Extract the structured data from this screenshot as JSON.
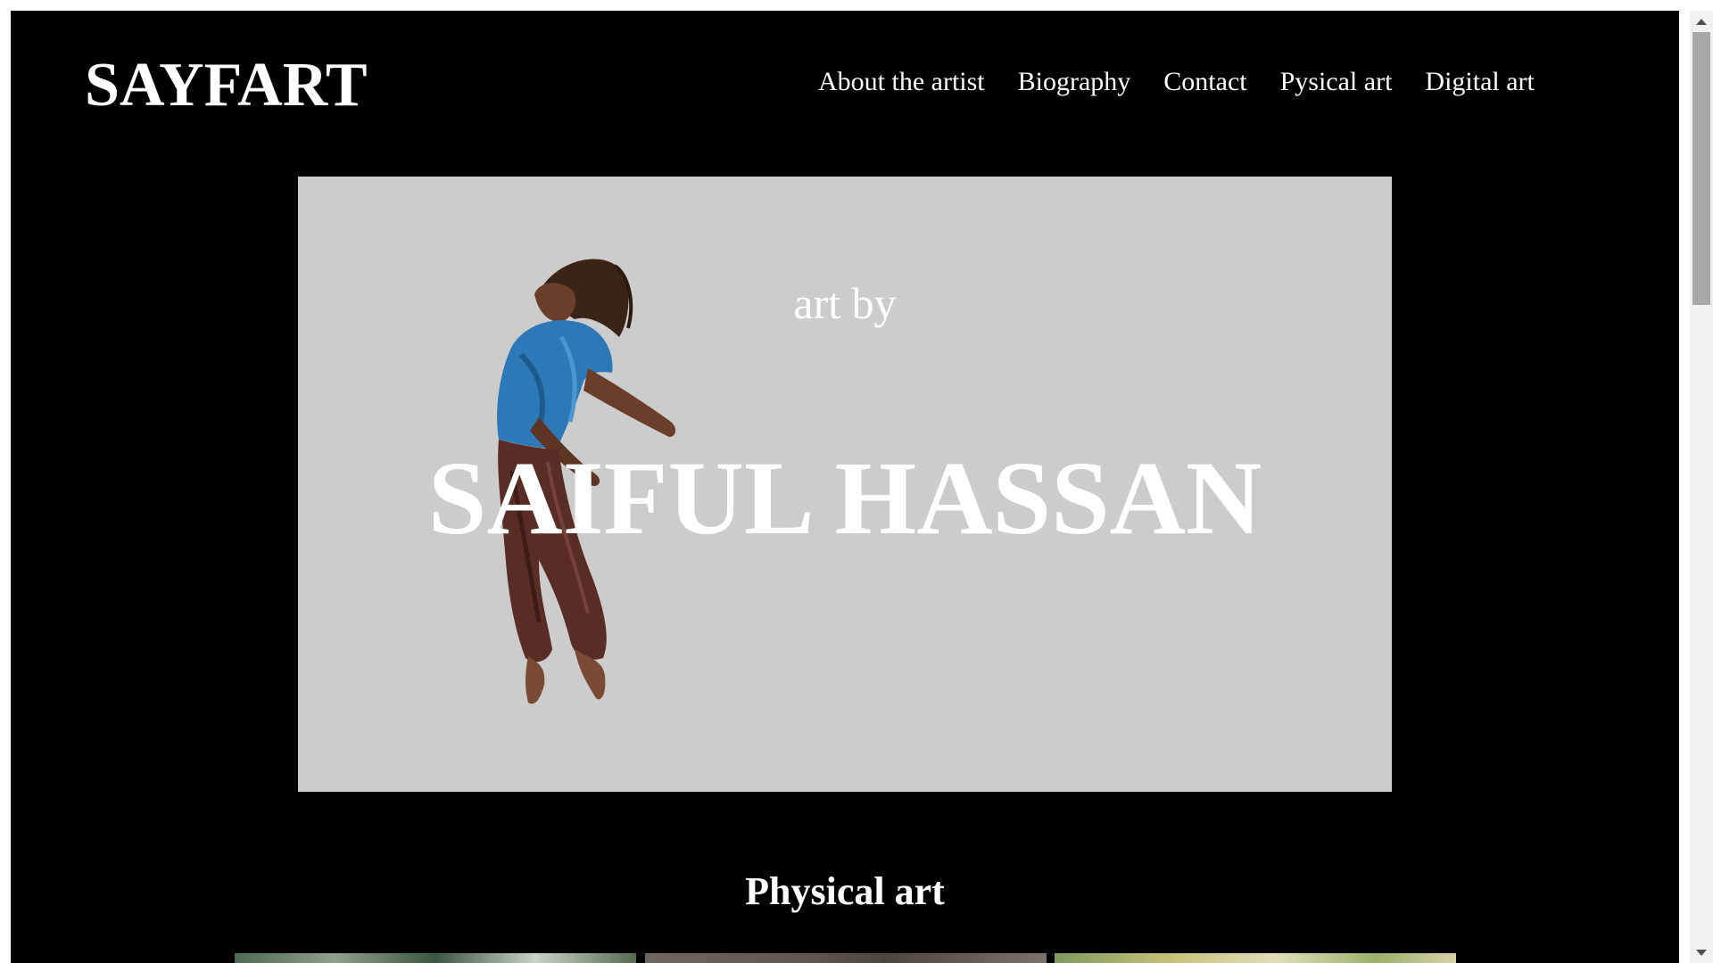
{
  "site": {
    "logo": "SAYFART"
  },
  "nav": {
    "items": [
      {
        "label": "About the artist"
      },
      {
        "label": "Biography"
      },
      {
        "label": "Contact"
      },
      {
        "label": "Pysical art"
      },
      {
        "label": "Digital art"
      }
    ]
  },
  "hero": {
    "subtitle": "art by",
    "title": "SAIFUL HASSAN",
    "background_color": "#cccccc",
    "image": "painting of a person leaping backwards wearing a blue t-shirt"
  },
  "physical_art": {
    "heading": "Physical art",
    "thumbnails": [
      {
        "icon": "artwork-thumbnail"
      },
      {
        "icon": "artwork-thumbnail"
      },
      {
        "icon": "artwork-thumbnail"
      }
    ]
  },
  "colors": {
    "page_background": "#000000",
    "text": "#ffffff",
    "hero_background": "#cccccc"
  }
}
